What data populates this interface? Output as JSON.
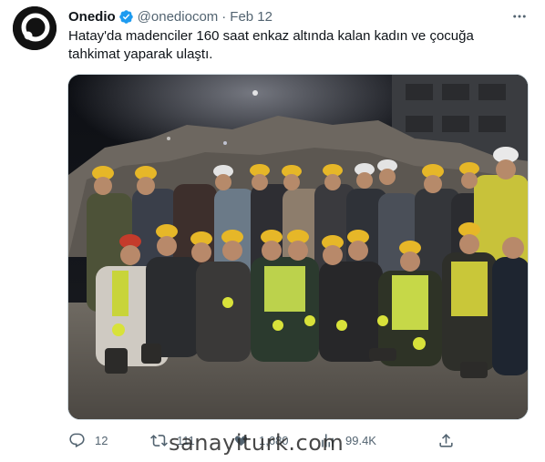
{
  "tweet": {
    "author_name": "Onedio",
    "handle": "@onediocom",
    "separator": "·",
    "date": "Feb 12",
    "text_line1": "Hatay'da madenciler 160 saat enkaz altında kalan kadın ve çocuğa",
    "text_line2": "tahkimat yaparak ulaştı."
  },
  "actions": {
    "replies": "12",
    "retweets": "111",
    "likes": "1,680",
    "views": "99.4K"
  },
  "watermark": "sanayiturk.com",
  "colors": {
    "verified": "#1d9bf0",
    "text": "#0f1419",
    "muted": "#536471"
  },
  "icons": [
    "onedio-logo",
    "verified-badge-icon",
    "more-icon",
    "reply-icon",
    "retweet-icon",
    "like-icon",
    "views-icon",
    "share-icon"
  ]
}
